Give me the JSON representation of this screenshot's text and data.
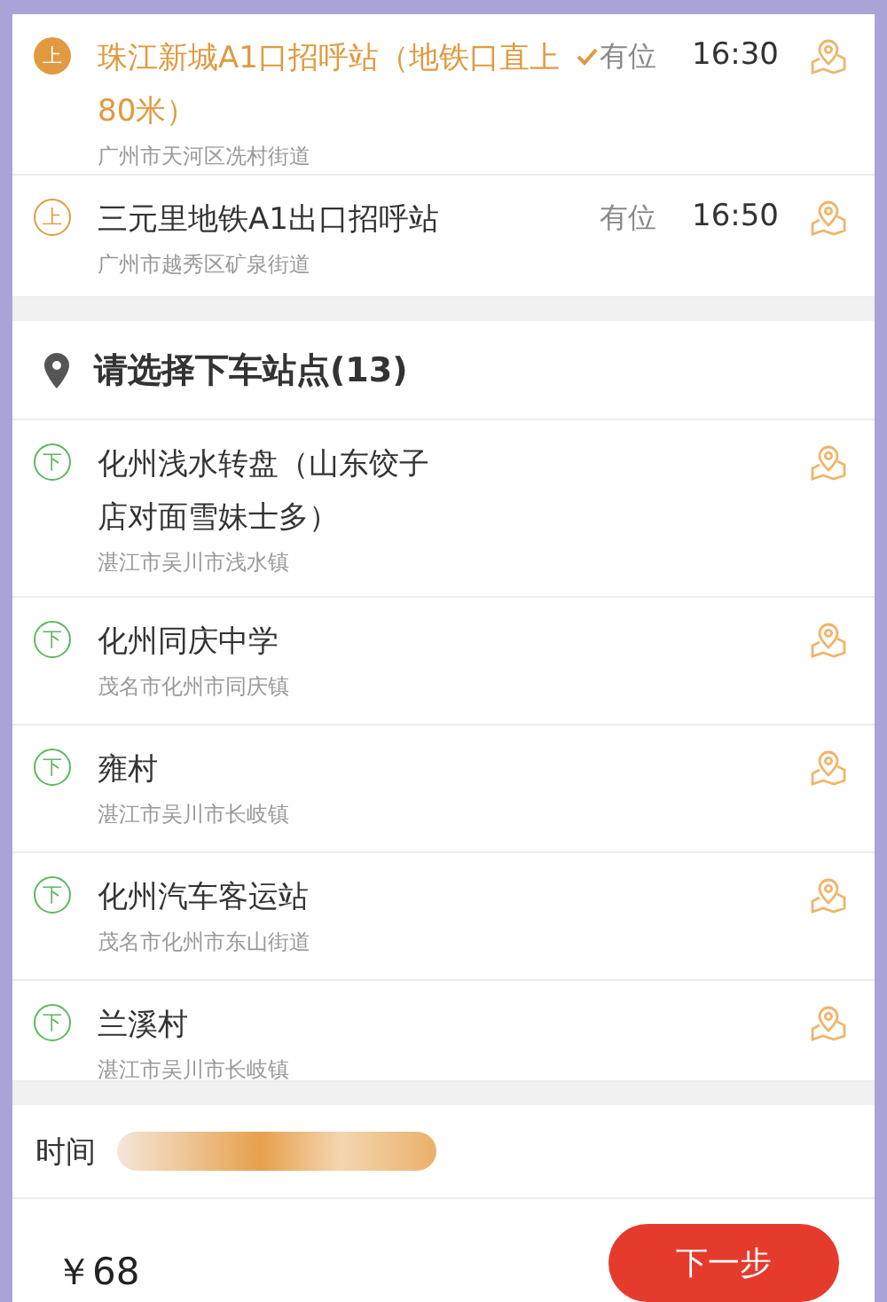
{
  "pickup_stops": [
    {
      "badge": "上",
      "name": "珠江新城A1口招呼站（地铁口直上80米）",
      "address": "广州市天河区冼村街道",
      "availability": "有位",
      "time": "16:30",
      "selected": true
    },
    {
      "badge": "上",
      "name": "三元里地铁A1出口招呼站",
      "address": "广州市越秀区矿泉街道",
      "availability": "有位",
      "time": "16:50",
      "selected": false
    }
  ],
  "dropoff_header": {
    "title": "请选择下车站点(13)"
  },
  "dropoff_stops": [
    {
      "badge": "下",
      "name": "化州浅水转盘（山东饺子店对面雪妹士多）",
      "address": "湛江市吴川市浅水镇"
    },
    {
      "badge": "下",
      "name": "化州同庆中学",
      "address": "茂名市化州市同庆镇"
    },
    {
      "badge": "下",
      "name": "雍村",
      "address": "湛江市吴川市长岐镇"
    },
    {
      "badge": "下",
      "name": "化州汽车客运站",
      "address": "茂名市化州市东山街道"
    },
    {
      "badge": "下",
      "name": "兰溪村",
      "address": "湛江市吴川市长岐镇"
    }
  ],
  "time_row": {
    "label": "时间"
  },
  "footer": {
    "price": "￥68",
    "button": "下一步"
  }
}
